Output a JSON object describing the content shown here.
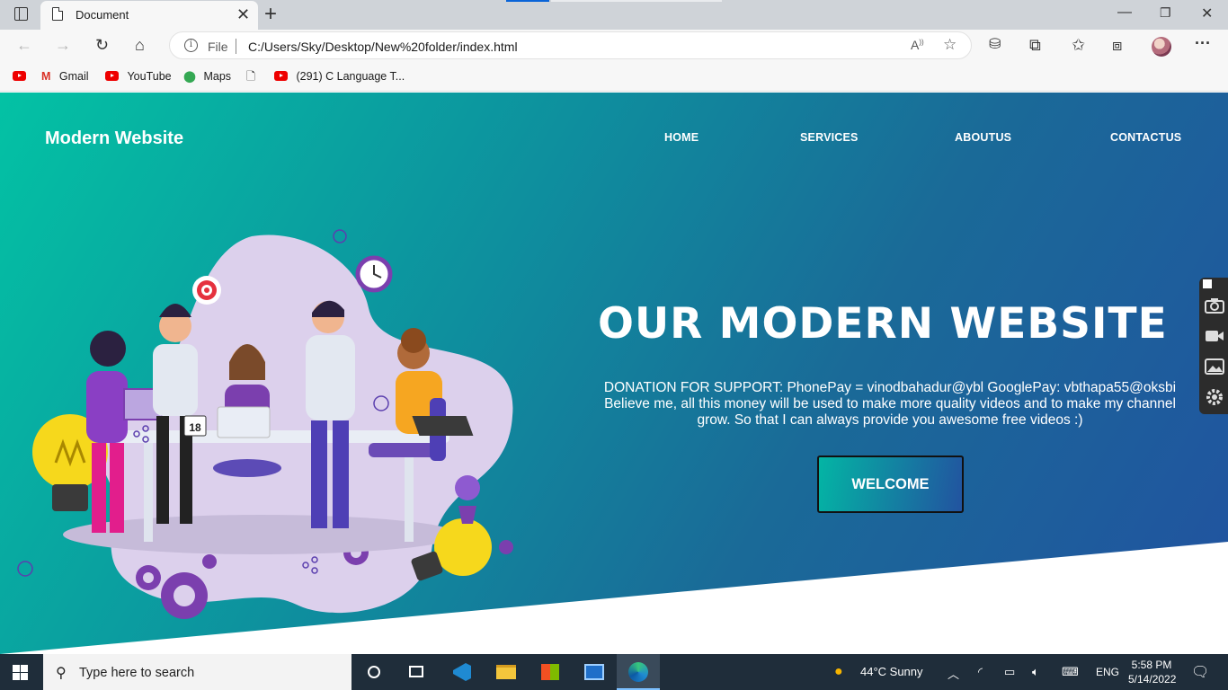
{
  "browser": {
    "tab_title": "Document",
    "address_protocol": "File",
    "address_url": "C:/Users/Sky/Desktop/New%20folder/index.html",
    "bookmarks": [
      "Gmail",
      "YouTube",
      "Maps",
      "(291) C Language T..."
    ]
  },
  "site": {
    "brand": "Modern Website",
    "nav": [
      "HOME",
      "SERVICES",
      "ABOUTUS",
      "CONTACTUS"
    ],
    "hero_title": "OUR MODERN WEBSITE",
    "hero_text": "DONATION FOR SUPPORT: PhonePay = vinodbahadur@ybl GooglePay: vbthapa55@oksbi Believe me, all this money will be used to make more quality videos and to make my channel grow. So that I can always provide you awesome free videos :)",
    "cta": "WELCOME",
    "illustration_calendar": "18"
  },
  "taskbar": {
    "search_placeholder": "Type here to search",
    "weather": "44°C  Sunny",
    "language": "ENG",
    "time": "5:58 PM",
    "date": "5/14/2022"
  },
  "colors": {
    "hero_gradient": [
      "#03c2a4",
      "#0e8f9e",
      "#1a6a98",
      "#2152a0"
    ],
    "taskbar": "#1f2d3a",
    "chrome": "#f7f7f7"
  }
}
